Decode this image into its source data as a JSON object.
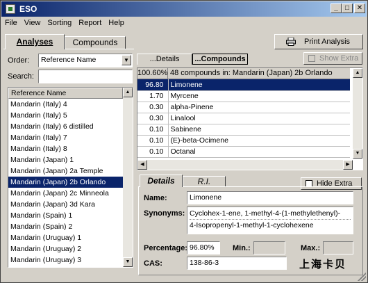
{
  "window": {
    "title": "ESO",
    "min": "_",
    "max": "□",
    "close": "✕"
  },
  "menu": [
    "File",
    "View",
    "Sorting",
    "Report",
    "Help"
  ],
  "left_tabs": {
    "analyses": "Analyses",
    "compounds": "Compounds"
  },
  "print_button": "Print Analysis",
  "order": {
    "label": "Order:",
    "value": "Reference Name"
  },
  "search": {
    "label": "Search:",
    "value": ""
  },
  "ref_list": {
    "header": "Reference Name",
    "items": [
      "Mandarin (Italy) 4",
      "Mandarin (Italy) 5",
      "Mandarin (Italy) 6 distilled",
      "Mandarin (Italy) 7",
      "Mandarin (Italy) 8",
      "Mandarin (Japan) 1",
      "Mandarin (Japan) 2a Temple",
      "Mandarin (Japan) 2b Orlando",
      "Mandarin (Japan) 2c Minneola",
      "Mandarin (Japan) 3d Kara",
      "Mandarin (Spain) 1",
      "Mandarin (Spain) 2",
      "Mandarin (Uruguay) 1",
      "Mandarin (Uruguay) 2",
      "Mandarin (Uruguay) 3"
    ],
    "selected_index": 7
  },
  "right_tabs": {
    "details": "...Details",
    "compounds": "...Compounds"
  },
  "show_extra": "Show Extra",
  "compounds": {
    "header_pct": "100.60%",
    "header_text": "48 compounds in: Mandarin (Japan) 2b Orlando",
    "rows": [
      {
        "pct": "96.80",
        "name": "Limonene"
      },
      {
        "pct": "1.70",
        "name": "Myrcene"
      },
      {
        "pct": "0.30",
        "name": "alpha-Pinene"
      },
      {
        "pct": "0.30",
        "name": "Linalool"
      },
      {
        "pct": "0.10",
        "name": "Sabinene"
      },
      {
        "pct": "0.10",
        "name": "(E)-beta-Ocimene"
      },
      {
        "pct": "0.10",
        "name": "Octanal"
      }
    ],
    "selected_index": 0
  },
  "detail_tabs": {
    "details": "Details",
    "ri": "R.I."
  },
  "hide_extra": "Hide Extra",
  "details": {
    "name_label": "Name:",
    "name": "Limonene",
    "synonyms_label": "Synonyms:",
    "synonyms": [
      "Cyclohex-1-ene, 1-methyl-4-(1-methylethenyl)-",
      "4-Isopropenyl-1-methyl-1-cyclohexene"
    ],
    "percentage_label": "Percentage:",
    "percentage": "96.80%",
    "min_label": "Min.:",
    "max_label": "Max.:",
    "cas_label": "CAS:",
    "cas": "138-86-3",
    "stamp": "上海卡贝"
  }
}
